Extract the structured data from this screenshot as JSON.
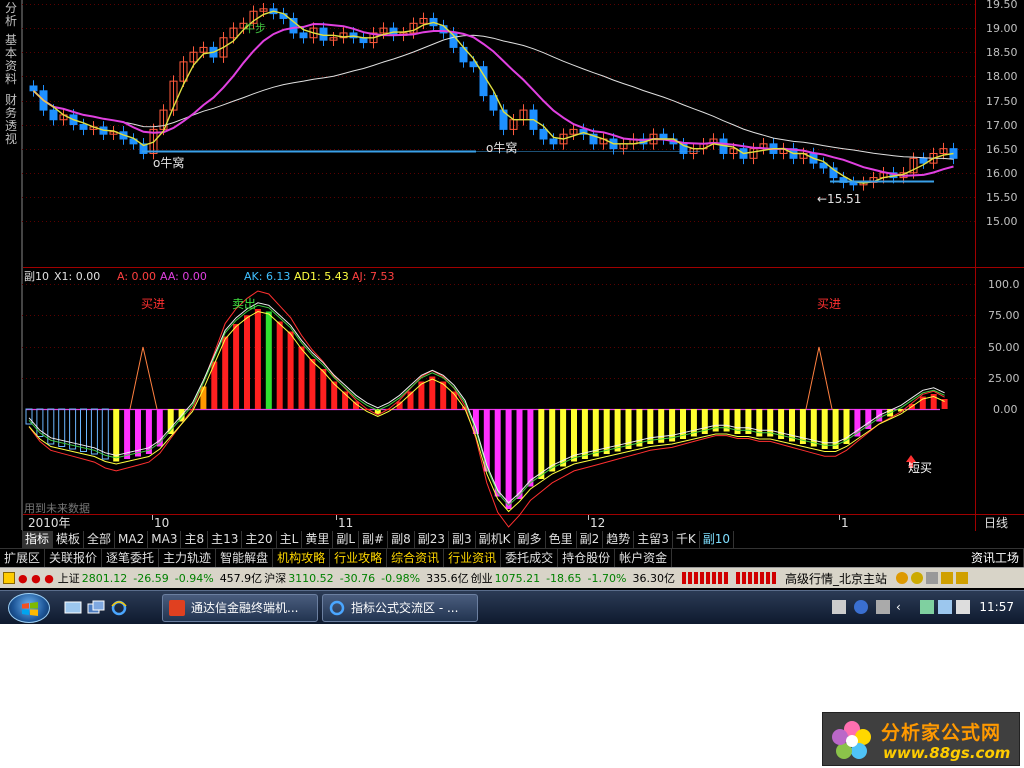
{
  "side_tabs": [
    {
      "label": "分析"
    },
    {
      "label": "基本资料"
    },
    {
      "label": "财务透视"
    }
  ],
  "price_chart": {
    "price_axis_labels": [
      "19.50",
      "19.00",
      "18.50",
      "18.00",
      "17.50",
      "17.00",
      "16.50",
      "16.00",
      "15.50",
      "15.00"
    ],
    "annotations": {
      "niuwo_1": "o牛窝",
      "niuwo_2": "o牛窝",
      "low_marker": "←15.51",
      "niubu": "牛步"
    },
    "colors": {
      "up": "#ff5a3c",
      "down": "#1e90ff",
      "ma_short": "#e0e040",
      "ma_mid": "#e040e0",
      "ma_long": "#e0e0e0",
      "support": "#3aa0e8"
    }
  },
  "indicator": {
    "header": {
      "name": "副10",
      "x1": "X1: 0.00",
      "a": "A: 0.00",
      "aa": "AA: 0.00",
      "ak": "AK: 6.13",
      "ad1": "AD1: 5.43",
      "aj": "AJ: 7.53"
    },
    "axis_labels": [
      "100.0",
      "75.00",
      "50.00",
      "25.00",
      "0.00"
    ],
    "annotations": {
      "buy_1": "买进",
      "buy_2": "买进",
      "sell": "卖出",
      "short_buy": "短买"
    },
    "watermark": "用到未来数据"
  },
  "date_axis": {
    "year_label": "2010年",
    "months": [
      "10",
      "11",
      "12",
      "1"
    ],
    "period": "日线"
  },
  "period_tabs": [
    "指标",
    "模板",
    "全部",
    "MA2",
    "MA3",
    "主8",
    "主13",
    "主20",
    "主L",
    "黄里",
    "副L",
    "副#",
    "副8",
    "副23",
    "副3",
    "副机K",
    "副多",
    "色里",
    "副2",
    "趋势",
    "主留3",
    "千K",
    "副10"
  ],
  "active_period_tab": "副10",
  "function_bar": {
    "items": [
      {
        "label": "扩展区",
        "highlight": false
      },
      {
        "label": "关联报价",
        "highlight": false
      },
      {
        "label": "逐笔委托",
        "highlight": false
      },
      {
        "label": "主力轨迹",
        "highlight": false
      },
      {
        "label": "智能解盘",
        "highlight": false
      },
      {
        "label": "机构攻略",
        "highlight": true
      },
      {
        "label": "行业攻略",
        "highlight": true
      },
      {
        "label": "综合资讯",
        "highlight": true
      },
      {
        "label": "行业资讯",
        "highlight": true
      },
      {
        "label": "委托成交",
        "highlight": false
      },
      {
        "label": "持仓股份",
        "highlight": false
      },
      {
        "label": "帐户资金",
        "highlight": false
      }
    ],
    "right_label": "资讯工场"
  },
  "status_bar": {
    "sh_label": "上证",
    "sh_index": "2801.12",
    "sh_change": "-26.59",
    "sh_pct": "-0.94%",
    "sh_volume": "457.9亿",
    "sz_label": "沪深",
    "sz_index": "3110.52",
    "sz_change": "-30.76",
    "sz_pct": "-0.98%",
    "sz_volume": "335.6亿",
    "cy_label": "创业",
    "cy_index": "1075.21",
    "cy_change": "-18.65",
    "cy_pct": "-1.70%",
    "cy_volume": "36.30亿",
    "server": "高级行情_北京主站"
  },
  "taskbar": {
    "tasks": [
      {
        "label": "通达信金融终端机..."
      },
      {
        "label": "指标公式交流区 - ..."
      }
    ],
    "clock": "11:57"
  },
  "watermark_logo": {
    "title": "分析家公式网",
    "url": "www.88gs.com"
  }
}
